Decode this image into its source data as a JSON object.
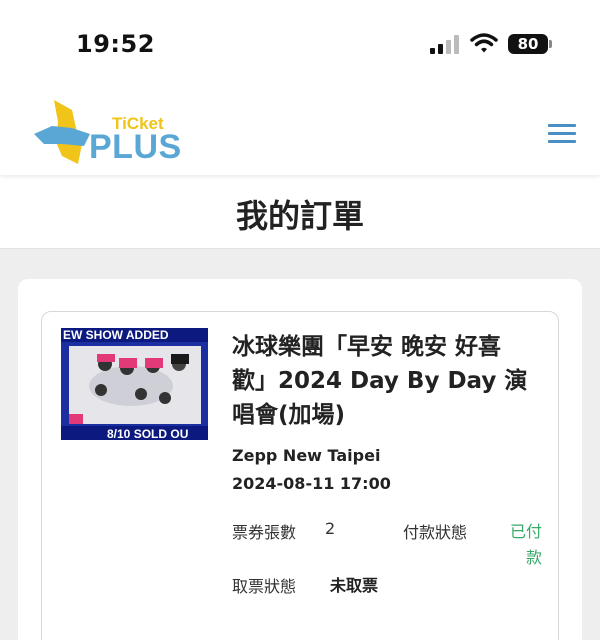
{
  "status_bar": {
    "time": "19:52",
    "battery": "80"
  },
  "header": {
    "logo_top": "TiCket",
    "logo_bottom": "PLUS"
  },
  "page": {
    "title": "我的訂單"
  },
  "order": {
    "thumbnail": {
      "top_banner": "EW SHOW ADDED",
      "bottom_banner": "8/10 SOLD OU"
    },
    "event_title": "冰球樂團「早安 晚安 好喜歡」2024 Day By Day 演唱會(加場)",
    "venue": "Zepp New Taipei",
    "datetime": "2024-08-11 17:00",
    "ticket_count_label": "票券張數",
    "ticket_count_value": "2",
    "payment_status_label": "付款狀態",
    "payment_status_value": "已付款",
    "pickup_status_label": "取票狀態",
    "pickup_status_value": "未取票"
  },
  "colors": {
    "paid_green": "#3aa86b",
    "menu_blue": "#4a8fc4",
    "logo_yellow": "#f0c419",
    "logo_blue": "#5aa7d6"
  }
}
